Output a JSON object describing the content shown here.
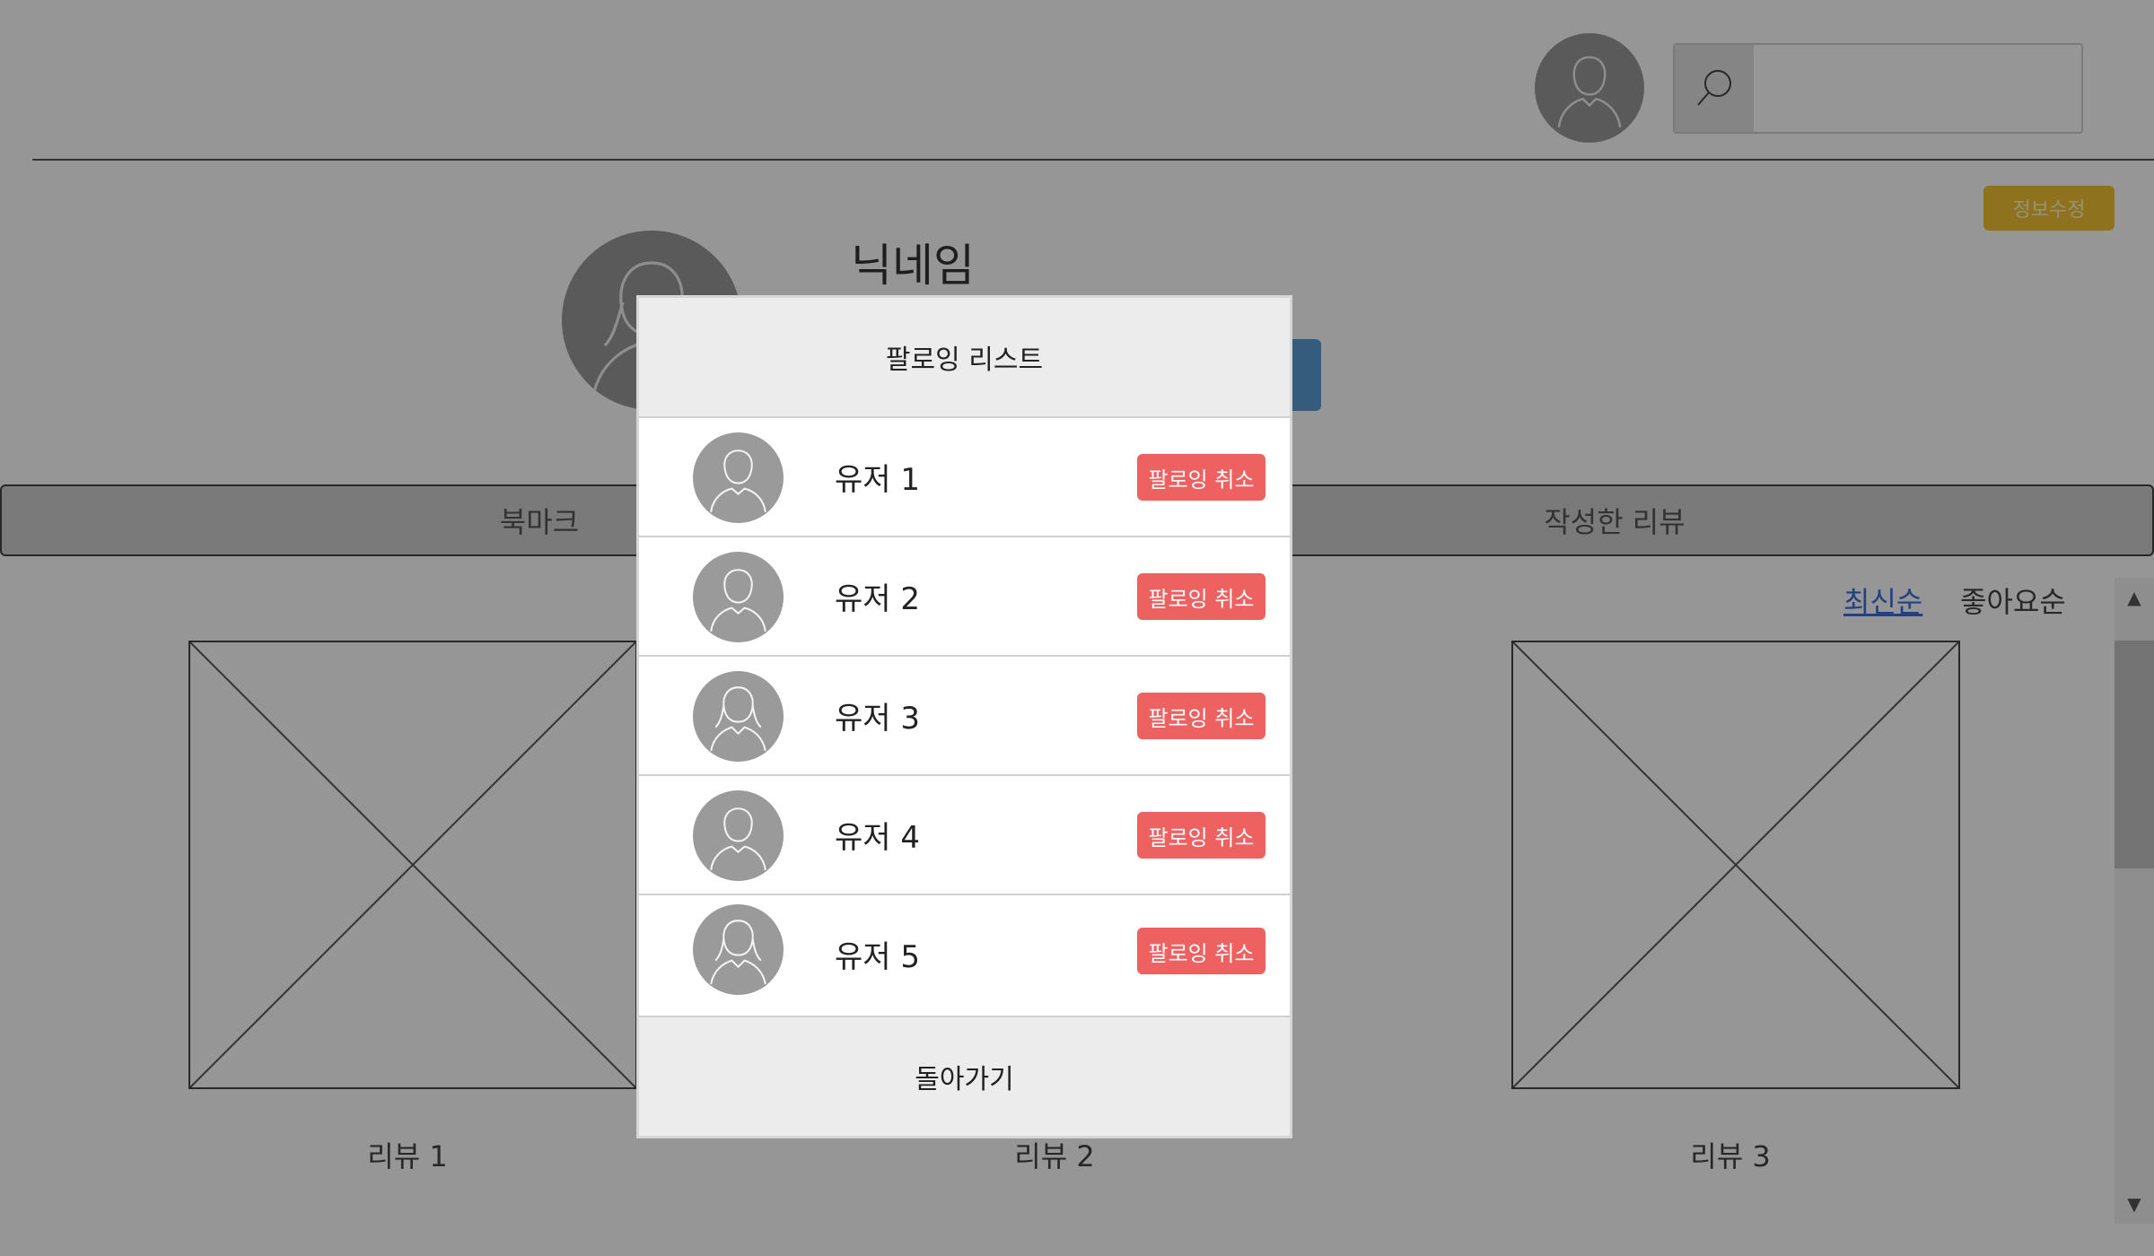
{
  "header": {
    "search": {
      "placeholder": ""
    }
  },
  "profile": {
    "nickname": "닉네임",
    "edit_label": "정보수정"
  },
  "tabs": [
    {
      "label": "북마크"
    },
    {
      "label": "작성한 리뷰"
    }
  ],
  "sort": {
    "latest": "최신순",
    "likes": "좋아요순"
  },
  "reviews": [
    {
      "label": "리뷰 1"
    },
    {
      "label": "리뷰 2"
    },
    {
      "label": "리뷰 3"
    }
  ],
  "modal": {
    "title": "팔로잉 리스트",
    "users": [
      {
        "name": "유저 1",
        "action": "팔로잉 취소",
        "avatar_icon": "male-user-icon"
      },
      {
        "name": "유저 2",
        "action": "팔로잉 취소",
        "avatar_icon": "male-user-icon"
      },
      {
        "name": "유저 3",
        "action": "팔로잉 취소",
        "avatar_icon": "female-user-icon"
      },
      {
        "name": "유저 4",
        "action": "팔로잉 취소",
        "avatar_icon": "male-user-icon"
      },
      {
        "name": "유저 5",
        "action": "팔로잉 취소",
        "avatar_icon": "female-user-icon"
      }
    ],
    "back_label": "돌아가기"
  },
  "colors": {
    "edit_button": "#f1c232",
    "follow_button": "#5b9bd5",
    "unfollow_button": "#ee6161",
    "sort_active": "#3d6fd6"
  }
}
